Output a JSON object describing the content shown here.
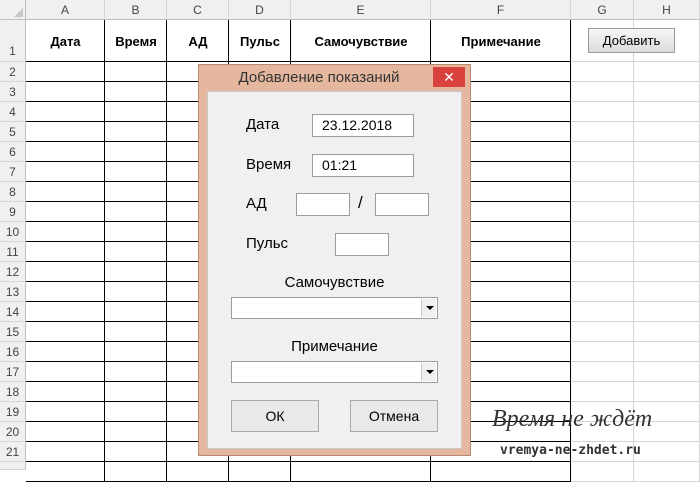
{
  "spreadsheet": {
    "columns": [
      "A",
      "B",
      "C",
      "D",
      "E",
      "F",
      "G",
      "H"
    ],
    "rows": [
      "1",
      "2",
      "3",
      "4",
      "5",
      "6",
      "7",
      "8",
      "9",
      "10",
      "11",
      "12",
      "13",
      "14",
      "15",
      "16",
      "17",
      "18",
      "19",
      "20",
      "21"
    ],
    "table_headers": [
      "Дата",
      "Время",
      "АД",
      "Пульс",
      "Самочувствие",
      "Примечание"
    ],
    "add_button_label": "Добавить"
  },
  "dialog": {
    "title": "Добавление показаний",
    "close_glyph": "✕",
    "date_label": "Дата",
    "date_value": "23.12.2018",
    "time_label": "Время",
    "time_value": "01:21",
    "bp_label": "АД",
    "bp_separator": "/",
    "bp_systolic_value": "",
    "bp_diastolic_value": "",
    "pulse_label": "Пульс",
    "pulse_value": "",
    "wellbeing_label": "Самочувствие",
    "wellbeing_value": "",
    "note_label": "Примечание",
    "note_value": "",
    "ok_label": "ОК",
    "cancel_label": "Отмена"
  },
  "watermark": {
    "line1": "Время не ждёт",
    "line2": "vremya-ne-zhdet.ru"
  }
}
